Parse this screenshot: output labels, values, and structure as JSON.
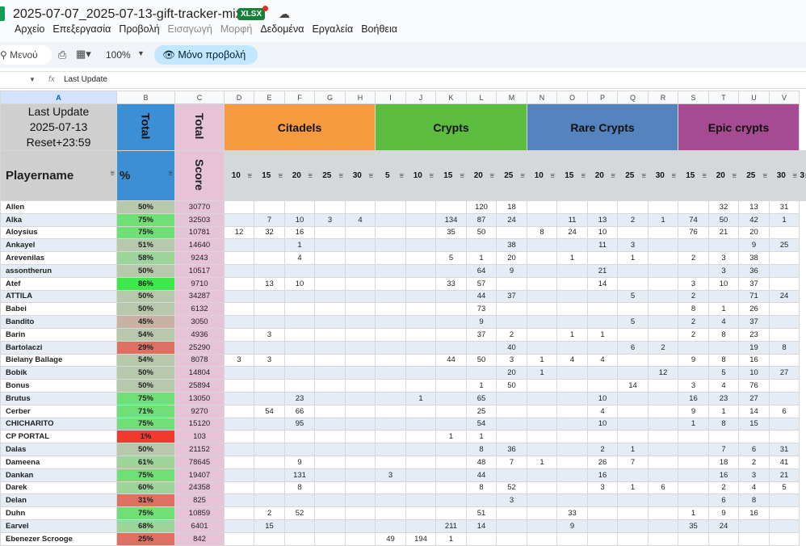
{
  "doc": {
    "title": "2025-07-07_2025-07-13-gift-tracker-mixt",
    "badge": "XLSX"
  },
  "menu": [
    "Αρχείο",
    "Επεξεργασία",
    "Προβολή",
    "Εισαγωγή",
    "Μορφή",
    "Δεδομένα",
    "Εργαλεία",
    "Βοήθεια"
  ],
  "menu_disabled": [
    3,
    4
  ],
  "toolbar": {
    "search": "Μενού",
    "zoom": "100%",
    "view_only": "Μόνο προβολή"
  },
  "formula": {
    "fx": "fx",
    "value": "Last Update"
  },
  "columns": [
    "A",
    "B",
    "C",
    "D",
    "E",
    "F",
    "G",
    "H",
    "I",
    "J",
    "K",
    "L",
    "M",
    "N",
    "O",
    "P",
    "Q",
    "R",
    "S",
    "T",
    "U",
    "V"
  ],
  "header": {
    "last_update": "Last Update\n2025-07-13\nReset+23:59",
    "total_b": "Total",
    "total_c": "Total",
    "score": "Score",
    "playername": "Playername",
    "pct": "%",
    "groups": [
      "Citadels",
      "Crypts",
      "Rare Crypts",
      "Epic crypts"
    ],
    "levels": [
      "10",
      "15",
      "20",
      "25",
      "30",
      "5",
      "10",
      "15",
      "20",
      "25",
      "10",
      "15",
      "20",
      "25",
      "30",
      "15",
      "20",
      "25",
      "30",
      "3"
    ]
  },
  "colors": {
    "citadels": "#f59a3f",
    "crypts": "#5bbc3f",
    "rare_crypts": "#5583bd",
    "epic_crypts": "#a64a92",
    "score_col": "#e6c3d7"
  },
  "rows": [
    {
      "name": "Allen",
      "pct": "50%",
      "score": "30770",
      "v": [
        "",
        "",
        "",
        "",
        "",
        "",
        "",
        "",
        "120",
        "18",
        "",
        "",
        "",
        "",
        "",
        "",
        "32",
        "13",
        "31"
      ]
    },
    {
      "name": "Alka",
      "pct": "75%",
      "score": "32503",
      "v": [
        "",
        "7",
        "10",
        "3",
        "4",
        "",
        "",
        "134",
        "87",
        "24",
        "",
        "11",
        "13",
        "2",
        "1",
        "74",
        "50",
        "42",
        "1"
      ]
    },
    {
      "name": "Aloysius",
      "pct": "75%",
      "score": "10781",
      "v": [
        "12",
        "32",
        "16",
        "",
        "",
        "",
        "",
        "35",
        "50",
        "",
        "8",
        "24",
        "10",
        "",
        "",
        "76",
        "21",
        "20",
        ""
      ]
    },
    {
      "name": "Ankayel",
      "pct": "51%",
      "score": "14640",
      "v": [
        "",
        "",
        "1",
        "",
        "",
        "",
        "",
        "",
        "",
        "38",
        "",
        "",
        "11",
        "3",
        "",
        "",
        "",
        "9",
        "25"
      ]
    },
    {
      "name": "Arevenilas",
      "pct": "58%",
      "score": "9243",
      "v": [
        "",
        "",
        "4",
        "",
        "",
        "",
        "",
        "5",
        "1",
        "20",
        "",
        "1",
        "",
        "1",
        "",
        "2",
        "3",
        "38",
        ""
      ]
    },
    {
      "name": "assontherun",
      "pct": "50%",
      "score": "10517",
      "v": [
        "",
        "",
        "",
        "",
        "",
        "",
        "",
        "",
        "64",
        "9",
        "",
        "",
        "21",
        "",
        "",
        "",
        "3",
        "36",
        ""
      ]
    },
    {
      "name": "Atef",
      "pct": "86%",
      "score": "9710",
      "v": [
        "",
        "13",
        "10",
        "",
        "",
        "",
        "",
        "33",
        "57",
        "",
        "",
        "",
        "14",
        "",
        "",
        "3",
        "10",
        "37",
        ""
      ]
    },
    {
      "name": "ATTILA",
      "pct": "50%",
      "score": "34287",
      "v": [
        "",
        "",
        "",
        "",
        "",
        "",
        "",
        "",
        "44",
        "37",
        "",
        "",
        "",
        "5",
        "",
        "2",
        "",
        "71",
        "24"
      ]
    },
    {
      "name": "Babei",
      "pct": "50%",
      "score": "6132",
      "v": [
        "",
        "",
        "",
        "",
        "",
        "",
        "",
        "",
        "73",
        "",
        "",
        "",
        "",
        "",
        "",
        "8",
        "1",
        "26",
        ""
      ]
    },
    {
      "name": "Bandito",
      "pct": "45%",
      "score": "3050",
      "v": [
        "",
        "",
        "",
        "",
        "",
        "",
        "",
        "",
        "9",
        "",
        "",
        "",
        "",
        "5",
        "",
        "2",
        "4",
        "37",
        ""
      ]
    },
    {
      "name": "Barin",
      "pct": "54%",
      "score": "4936",
      "v": [
        "",
        "3",
        "",
        "",
        "",
        "",
        "",
        "",
        "37",
        "2",
        "",
        "1",
        "1",
        "",
        "",
        "2",
        "8",
        "23",
        ""
      ]
    },
    {
      "name": "Bartolaczi",
      "pct": "29%",
      "score": "25290",
      "v": [
        "",
        "",
        "",
        "",
        "",
        "",
        "",
        "",
        "",
        "40",
        "",
        "",
        "",
        "6",
        "2",
        "",
        "",
        "19",
        "8"
      ]
    },
    {
      "name": "Bielany Ballage",
      "pct": "54%",
      "score": "8078",
      "v": [
        "3",
        "3",
        "",
        "",
        "",
        "",
        "",
        "44",
        "50",
        "3",
        "1",
        "4",
        "4",
        "",
        "",
        "9",
        "8",
        "16",
        ""
      ]
    },
    {
      "name": "Bobik",
      "pct": "50%",
      "score": "14804",
      "v": [
        "",
        "",
        "",
        "",
        "",
        "",
        "",
        "",
        "",
        "20",
        "1",
        "",
        "",
        "",
        "12",
        "",
        "5",
        "10",
        "27"
      ]
    },
    {
      "name": "Bonus",
      "pct": "50%",
      "score": "25894",
      "v": [
        "",
        "",
        "",
        "",
        "",
        "",
        "",
        "",
        "1",
        "50",
        "",
        "",
        "",
        "14",
        "",
        "3",
        "4",
        "76",
        ""
      ]
    },
    {
      "name": "Brutus",
      "pct": "75%",
      "score": "13050",
      "v": [
        "",
        "",
        "23",
        "",
        "",
        "",
        "1",
        "",
        "65",
        "",
        "",
        "",
        "10",
        "",
        "",
        "16",
        "23",
        "27",
        ""
      ]
    },
    {
      "name": "Cerber",
      "pct": "71%",
      "score": "9270",
      "v": [
        "",
        "54",
        "66",
        "",
        "",
        "",
        "",
        "",
        "25",
        "",
        "",
        "",
        "4",
        "",
        "",
        "9",
        "1",
        "14",
        "6"
      ]
    },
    {
      "name": "CHICHARITO",
      "pct": "75%",
      "score": "15120",
      "v": [
        "",
        "",
        "95",
        "",
        "",
        "",
        "",
        "",
        "54",
        "",
        "",
        "",
        "10",
        "",
        "",
        "1",
        "8",
        "15",
        ""
      ]
    },
    {
      "name": "CP PORTAL",
      "pct": "1%",
      "score": "103",
      "v": [
        "",
        "",
        "",
        "",
        "",
        "",
        "",
        "1",
        "1",
        "",
        "",
        "",
        "",
        "",
        "",
        "",
        "",
        "",
        ""
      ]
    },
    {
      "name": "Dalas",
      "pct": "50%",
      "score": "21152",
      "v": [
        "",
        "",
        "",
        "",
        "",
        "",
        "",
        "",
        "8",
        "36",
        "",
        "",
        "2",
        "1",
        "",
        "",
        "7",
        "6",
        "31"
      ]
    },
    {
      "name": "Dameena",
      "pct": "61%",
      "score": "78645",
      "v": [
        "",
        "",
        "9",
        "",
        "",
        "",
        "",
        "",
        "48",
        "7",
        "1",
        "",
        "26",
        "7",
        "",
        "",
        "18",
        "2",
        "41"
      ]
    },
    {
      "name": "Dankan",
      "pct": "75%",
      "score": "19407",
      "v": [
        "",
        "",
        "131",
        "",
        "",
        "3",
        "",
        "",
        "44",
        "",
        "",
        "",
        "16",
        "",
        "",
        "",
        "16",
        "3",
        "21"
      ]
    },
    {
      "name": "Darek",
      "pct": "60%",
      "score": "24358",
      "v": [
        "",
        "",
        "8",
        "",
        "",
        "",
        "",
        "",
        "8",
        "52",
        "",
        "",
        "3",
        "1",
        "6",
        "",
        "2",
        "4",
        "5"
      ]
    },
    {
      "name": "Delan",
      "pct": "31%",
      "score": "825",
      "v": [
        "",
        "",
        "",
        "",
        "",
        "",
        "",
        "",
        "",
        "3",
        "",
        "",
        "",
        "",
        "",
        "",
        "6",
        "8",
        ""
      ]
    },
    {
      "name": "Duhn",
      "pct": "75%",
      "score": "10859",
      "v": [
        "",
        "2",
        "52",
        "",
        "",
        "",
        "",
        "",
        "51",
        "",
        "",
        "33",
        "",
        "",
        "",
        "1",
        "9",
        "16",
        ""
      ]
    },
    {
      "name": "Earvel",
      "pct": "68%",
      "score": "6401",
      "v": [
        "",
        "15",
        "",
        "",
        "",
        "",
        "",
        "211",
        "14",
        "",
        "",
        "9",
        "",
        "",
        "",
        "35",
        "24",
        "",
        ""
      ]
    },
    {
      "name": "Ebenezer Scrooge",
      "pct": "25%",
      "score": "842",
      "v": [
        "",
        "",
        "",
        "",
        "",
        "49",
        "194",
        "1",
        "",
        "",
        "",
        "",
        "",
        "",
        "",
        "",
        "",
        "",
        ""
      ]
    }
  ]
}
